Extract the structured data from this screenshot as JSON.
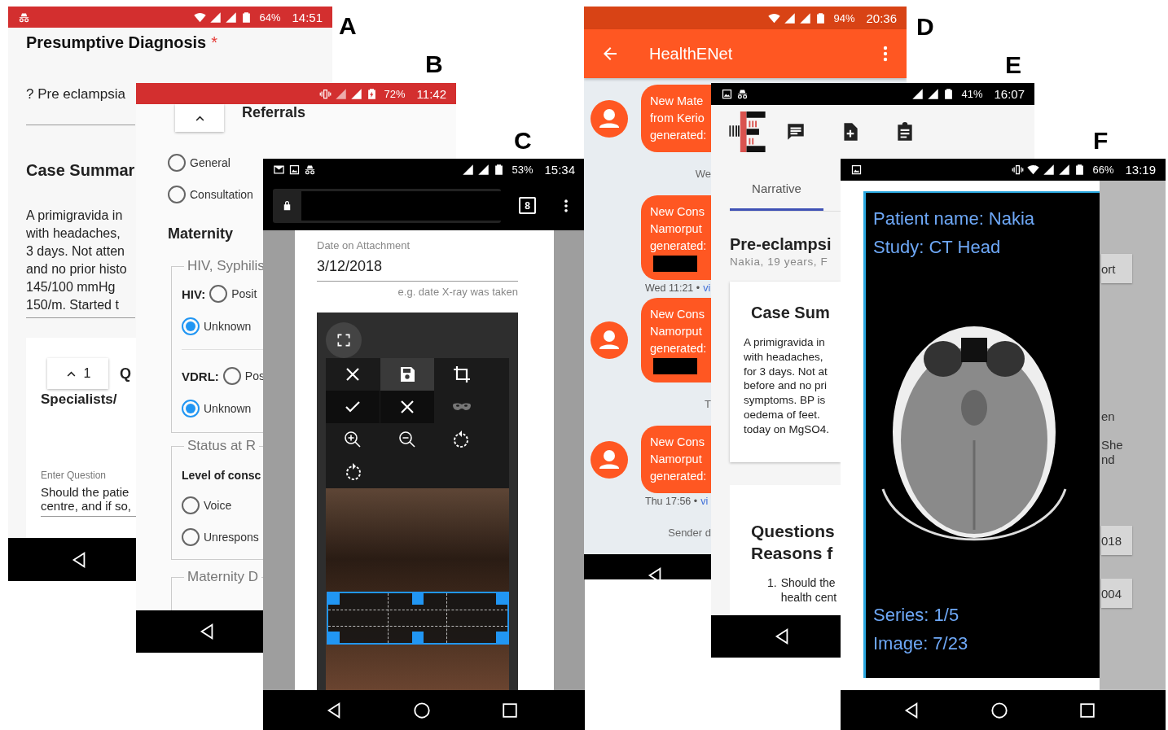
{
  "figure_labels": [
    "A",
    "B",
    "C",
    "D",
    "E",
    "F"
  ],
  "screen_a": {
    "status": {
      "battery": "64%",
      "time": "14:51"
    },
    "diagnosis": {
      "label": "Presumptive Diagnosis",
      "required": "*",
      "value": "? Pre eclampsia"
    },
    "case_summary": {
      "title": "Case Summar",
      "lines": [
        "A primigravida in",
        "with headaches,",
        "3 days. Not atten",
        "and no prior histo",
        "145/100 mmHg",
        "150/m. Started t"
      ]
    },
    "question_card": {
      "collapse_count": "1",
      "letter": "Q",
      "title": "Specialists/",
      "field_label": "Enter Question",
      "field_lines": [
        "Should the patie",
        "centre, and if so,"
      ]
    }
  },
  "screen_b": {
    "status": {
      "battery": "72%",
      "time": "11:42"
    },
    "section_title": "Referrals",
    "referral_options": [
      {
        "label": "General",
        "selected": false
      },
      {
        "label": "Consultation",
        "selected": false
      }
    ],
    "maternity_title": "Maternity",
    "hiv_group": {
      "legend": "HIV, Syphilis",
      "tests": [
        {
          "label": "HIV:",
          "options": [
            {
              "label": "Posit",
              "selected": false
            },
            {
              "label": "Unknown",
              "selected": true
            }
          ]
        },
        {
          "label": "VDRL:",
          "options": [
            {
              "label": "Pos",
              "selected": false
            },
            {
              "label": "Unknown",
              "selected": true
            }
          ]
        }
      ]
    },
    "status_group": {
      "legend": "Status at R",
      "question": "Level of consc",
      "options": [
        {
          "label": "Voice",
          "selected": false
        },
        {
          "label": "Unrespons",
          "selected": false
        }
      ]
    },
    "next_legend": "Maternity D"
  },
  "screen_c": {
    "status": {
      "battery": "53%",
      "time": "15:34"
    },
    "tab_count": "8",
    "date_field": {
      "label": "Date on Attachment",
      "value": "3/12/2018",
      "hint": "e.g. date X-ray was taken"
    }
  },
  "screen_d": {
    "status": {
      "battery": "94%",
      "time": "20:36"
    },
    "app_title": "HealthENet",
    "thread": [
      {
        "kind": "message",
        "avatar": true,
        "lines": [
          "New Mate",
          "from Kerio",
          "generated:"
        ],
        "redacted": false
      },
      {
        "kind": "divider",
        "text": "We"
      },
      {
        "kind": "message",
        "avatar": false,
        "lines": [
          "New Cons",
          "Namorput",
          "generated:"
        ],
        "redacted": true
      },
      {
        "kind": "meta",
        "time": "Wed 11:21 •",
        "link": "vi"
      },
      {
        "kind": "message",
        "avatar": true,
        "lines": [
          "New Cons",
          "Namorput",
          "generated:"
        ],
        "redacted": true
      },
      {
        "kind": "divider",
        "text": "T"
      },
      {
        "kind": "message",
        "avatar": true,
        "lines": [
          "New Cons",
          "Namorput",
          "generated:"
        ],
        "redacted": false
      },
      {
        "kind": "meta",
        "time": "Thu 17:56 •",
        "link": "vi"
      },
      {
        "kind": "divider",
        "text": "Sender d"
      }
    ]
  },
  "screen_e": {
    "status": {
      "battery": "41%",
      "time": "16:07"
    },
    "tabs": [
      {
        "label": "Narrative",
        "selected": true
      }
    ],
    "case_title": "Pre-eclampsi",
    "patient_line": "Nakia, 19 years, F",
    "summary_card": {
      "title": "Case Sum",
      "lines": [
        "A primigravida in",
        "with headaches,",
        "for 3 days. Not at",
        "before and no pri",
        "symptoms. BP is",
        "oedema of feet.",
        "today on MgSO4."
      ]
    },
    "questions_card": {
      "title_lines": [
        "Questions",
        "Reasons f"
      ],
      "items": [
        {
          "number": "1.",
          "lines": [
            "Should the",
            "health cent"
          ]
        }
      ]
    }
  },
  "screen_f": {
    "status": {
      "battery": "66%",
      "time": "13:19"
    },
    "viewer": {
      "patient": "Patient name: Nakia",
      "study": "Study: CT Head",
      "series": "Series: 1/5",
      "image": "Image: 7/23"
    },
    "background_cards": [
      {
        "buttons": [
          "ort"
        ]
      },
      {
        "lines": [
          "en",
          "She",
          "nd"
        ]
      },
      {
        "buttons": [
          "018",
          "004"
        ]
      }
    ]
  }
}
